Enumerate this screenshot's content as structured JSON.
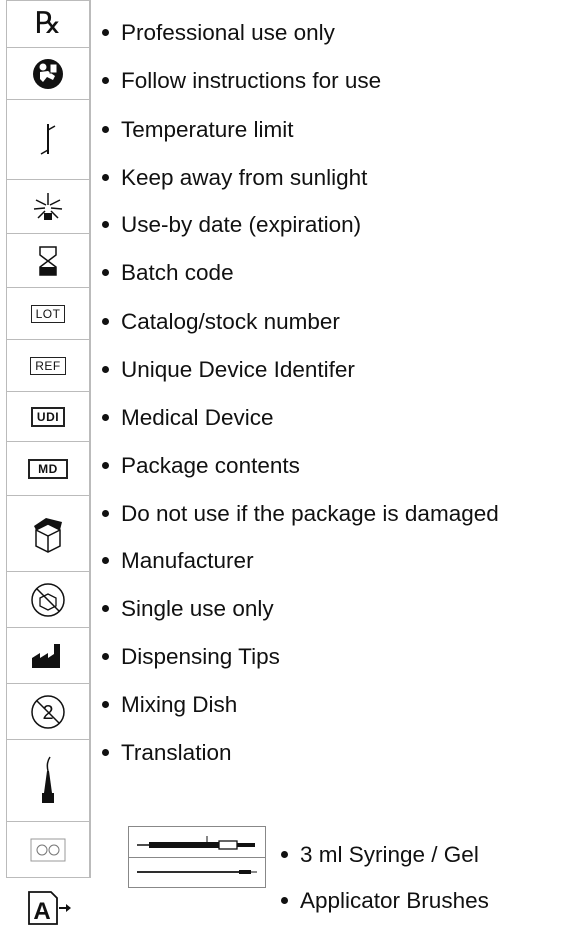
{
  "items": [
    "Professional use only",
    "Follow instructions for use",
    "Temperature limit",
    "Keep away from sunlight",
    "Use-by date (expiration)",
    "Batch code",
    "Catalog/stock number",
    "Unique Device Identifer",
    "Medical Device",
    "Package contents",
    "Do not use if the package is damaged",
    "Manufacturer",
    "Single use only",
    "Dispensing Tips",
    "Mixing Dish",
    "Translation"
  ],
  "kit_items": [
    "3 ml Syringe / Gel",
    "Applicator Brushes"
  ],
  "icons": {
    "rx": "℞",
    "lot": "LOT",
    "ref": "REF",
    "udi": "UDI",
    "md": "MD",
    "single_use": "2",
    "translation": "A"
  }
}
